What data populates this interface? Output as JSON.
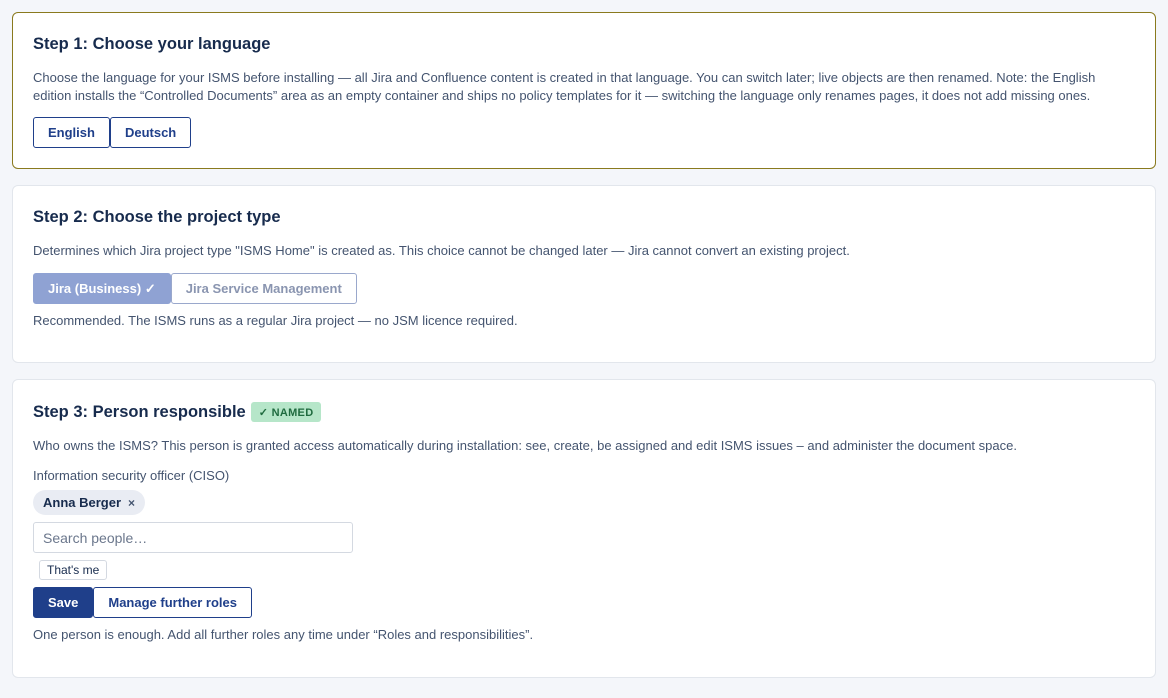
{
  "step1": {
    "title": "Step 1: Choose your language",
    "description": "Choose the language for your ISMS before installing — all Jira and Confluence content is created in that language. You can switch later; live objects are then renamed. Note: the English edition installs the “Controlled Documents” area as an empty container and ships no policy templates for it — switching the language only renames pages, it does not add missing ones.",
    "buttons": [
      "English",
      "Deutsch"
    ]
  },
  "step2": {
    "title": "Step 2: Choose the project type",
    "description": "Determines which Jira project type \"ISMS Home\" is created as. This choice cannot be changed later — Jira cannot convert an existing project.",
    "buttons": [
      "Jira (Business) ✓",
      "Jira Service Management"
    ],
    "selected": "Jira (Business)",
    "note": "Recommended. The ISMS runs as a regular Jira project — no JSM licence required."
  },
  "step3": {
    "title": "Step 3: Person responsible",
    "badge": "✓ NAMED",
    "description": "Who owns the ISMS? This person is granted access automatically during installation: see, create, be assigned and edit ISMS issues – and administer the document space.",
    "field_label": "Information security officer (CISO)",
    "chip_name": "Anna Berger",
    "chip_remove": "×",
    "search_placeholder": "Search people…",
    "search_value": "",
    "thats_me": "That's me",
    "save_label": "Save",
    "roles_label": "Manage further roles",
    "note": "One person is enough. Add all further roles any time under “Roles and responsibilities”."
  },
  "colors": {
    "accent": "#1f3f8a",
    "active_border": "#8a7a1e",
    "badge_bg": "#b6e6c9",
    "badge_text": "#1f6b3f"
  }
}
